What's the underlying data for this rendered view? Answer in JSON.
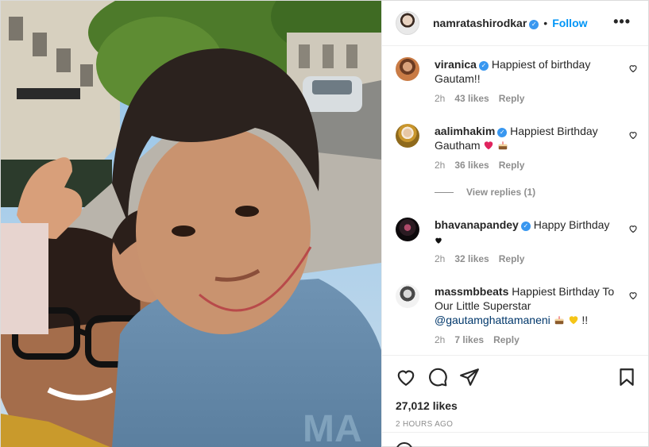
{
  "post": {
    "owner": {
      "username": "namratashirodkar",
      "verified": true,
      "follow_label": "Follow",
      "dot": "•",
      "more": "•••"
    },
    "comments": [
      {
        "username": "viranica",
        "verified": true,
        "text": "Happiest of birthday Gautam!!",
        "time": "2h",
        "likes": "43 likes",
        "reply": "Reply"
      },
      {
        "username": "aalimhakim",
        "verified": true,
        "text": "Happiest Birthday Gautham",
        "emojis": [
          "heart-red",
          "cake"
        ],
        "time": "2h",
        "likes": "36 likes",
        "reply": "Reply"
      },
      {
        "username": "bhavanapandey",
        "verified": true,
        "text": "Happy Birthday",
        "emojis": [
          "heart-black"
        ],
        "time": "2h",
        "likes": "32 likes",
        "reply": "Reply"
      },
      {
        "username": "massmbbeats",
        "verified": false,
        "text": "Happiest Birthday To Our Little Superstar",
        "mention": "@gautamghattamaneni",
        "suffix": "!!",
        "emojis": [
          "cake",
          "heart-yellow"
        ],
        "time": "2h",
        "likes": "7 likes",
        "reply": "Reply"
      }
    ],
    "view_replies": "View replies (1)",
    "likes_count": "27,012 likes",
    "posted_ago": "2 HOURS AGO",
    "icons": [
      "heart-icon",
      "comment-icon",
      "share-icon",
      "bookmark-icon",
      "emoji-icon",
      "more-icon"
    ],
    "colors": {
      "accent": "#0095f6",
      "verified": "#3897f0",
      "meta": "#8e8e8e",
      "text": "#262626"
    }
  }
}
